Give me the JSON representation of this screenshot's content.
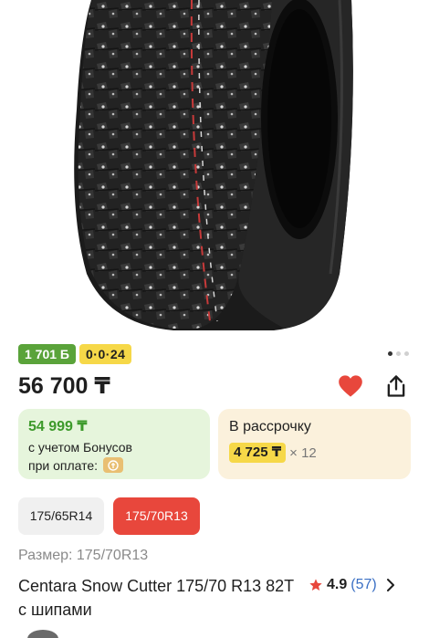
{
  "product_image": {
    "icon": "tire-image"
  },
  "badges": {
    "bonus": "1 701 Б",
    "installment": "0·0·24"
  },
  "gallery": {
    "pages": 3,
    "current": 1
  },
  "price": "56 700 ₸",
  "actions": {
    "favorite_icon": "heart-icon",
    "share_icon": "share-icon",
    "favorite_color": "#e8473c"
  },
  "bonus_card": {
    "amount": "54 999 ₸",
    "line1": "с учетом Бонусов",
    "line2": "при оплате:",
    "icon": "kaspi-pay-icon"
  },
  "installment_card": {
    "title": "В рассрочку",
    "amount": "4 725 ₸",
    "multiplier": "× 12"
  },
  "size_options": [
    {
      "label": "175/65R14",
      "selected": false
    },
    {
      "label": "175/70R13",
      "selected": true
    }
  ],
  "size_label": "Размер: 175/70R13",
  "product_name": "Centara Snow Cutter 175/70 R13 82T с шипами",
  "rating": {
    "value": "4.9",
    "count": "(57)",
    "star_color": "#e8473c"
  },
  "colors": {
    "accent": "#e8473c",
    "bonus_green": "#5aa33a",
    "installment_yellow": "#f6d848",
    "link_blue": "#3a6fc4"
  }
}
